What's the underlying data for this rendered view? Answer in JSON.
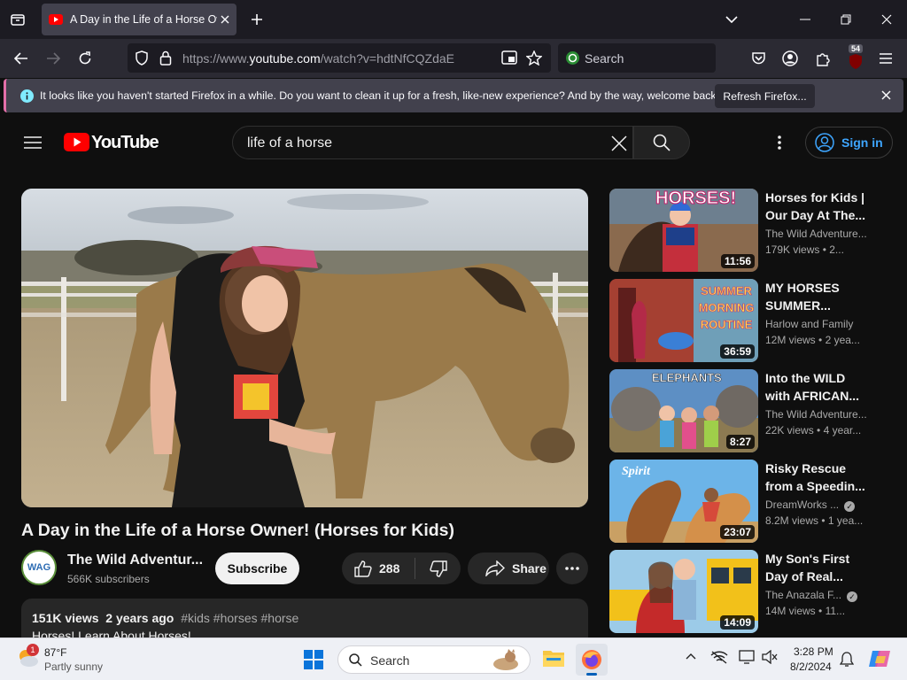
{
  "browser": {
    "tab_title": "A Day in the Life of a Horse Owner! (Horses for Kids)",
    "url_prefix": "https://www.",
    "url_domain": "youtube.com",
    "url_path": "/watch?v=hdtNfCQZdaE",
    "search_placeholder": "Search",
    "extension_badge": "54",
    "notification": "It looks like you haven't started Firefox in a while. Do you want to clean it up for a fresh, like-new experience? And by the way, welcome back!",
    "notification_button": "Refresh Firefox..."
  },
  "youtube": {
    "logo_text": "YouTube",
    "search_query": "life of a horse",
    "sign_in": "Sign in",
    "video": {
      "title": "A Day in the Life of a Horse Owner! (Horses for Kids)",
      "channel_name": "The Wild Adventur...",
      "channel_avatar_text": "WAG",
      "subscribers": "566K subscribers",
      "subscribe_label": "Subscribe",
      "likes": "288",
      "share_label": "Share",
      "views": "151K views",
      "age": "2 years ago",
      "hashtags": "#kids #horses #horse",
      "description_line": "Horses! Learn About Horses!"
    },
    "recommendations": [
      {
        "title_1": "Horses for Kids |",
        "title_2": "Our Day At The...",
        "channel": "The Wild Adventure...",
        "views": "179K views",
        "age": "2...",
        "duration": "11:56",
        "thumb_text": "HORSES!",
        "verified": false
      },
      {
        "title_1": "MY HORSES",
        "title_2": "SUMMER...",
        "channel": "Harlow and Family",
        "views": "12M views",
        "age": "2 yea...",
        "duration": "36:59",
        "thumb_text": "SUMMER MORNING ROUTINE",
        "verified": false
      },
      {
        "title_1": "Into the WILD",
        "title_2": "with AFRICAN...",
        "channel": "The Wild Adventure...",
        "views": "22K views",
        "age": "4 year...",
        "duration": "8:27",
        "thumb_text": "ELEPHANTS",
        "verified": false
      },
      {
        "title_1": "Risky Rescue",
        "title_2": "from a Speedin...",
        "channel": "DreamWorks ...",
        "views": "8.2M views",
        "age": "1 yea...",
        "duration": "23:07",
        "thumb_text": "Spirit",
        "verified": true
      },
      {
        "title_1": "My Son's First",
        "title_2": "Day of Real...",
        "channel": "The Anazala F...",
        "views": "14M views",
        "age": "11...",
        "duration": "14:09",
        "thumb_text": "",
        "verified": true
      }
    ]
  },
  "taskbar": {
    "weather_temp": "87°F",
    "weather_condition": "Partly sunny",
    "weather_badge": "1",
    "search_label": "Search",
    "time": "3:28 PM",
    "date": "8/2/2024"
  },
  "colors": {
    "youtube_red": "#ff0000",
    "link_blue": "#3ea6ff",
    "firefox_dark": "#1c1b22"
  }
}
